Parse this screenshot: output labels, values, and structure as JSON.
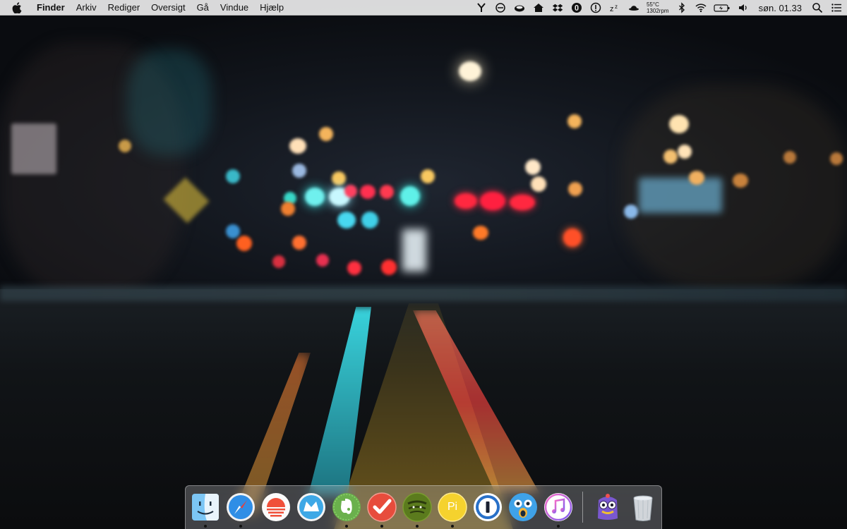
{
  "menubar": {
    "app_name": "Finder",
    "menus": [
      "Arkiv",
      "Rediger",
      "Oversigt",
      "Gå",
      "Vindue",
      "Hjælp"
    ],
    "status": {
      "temperature": "55°C",
      "fan_speed": "1302rpm",
      "clock": "søn. 01.33"
    }
  },
  "status_icons": [
    "fork-icon",
    "do-not-disturb-icon",
    "coffee-icon",
    "home-icon",
    "dropbox-icon",
    "info-circle-icon",
    "alert-circle-icon",
    "sleep-icon",
    "hat-icon",
    "bluetooth-icon",
    "wifi-icon",
    "battery-charging-icon",
    "volume-icon",
    "spotlight-search-icon",
    "notification-center-icon"
  ],
  "dock": {
    "apps": [
      {
        "name": "Finder",
        "icon": "finder-icon",
        "running": true
      },
      {
        "name": "Safari",
        "icon": "safari-icon",
        "running": true
      },
      {
        "name": "Sunrise",
        "icon": "sunrise-icon",
        "running": false
      },
      {
        "name": "Airmail",
        "icon": "airmail-icon",
        "running": false
      },
      {
        "name": "Evernote",
        "icon": "evernote-icon",
        "running": true
      },
      {
        "name": "Wunderlist",
        "icon": "wunderlist-icon",
        "running": true
      },
      {
        "name": "Spotify",
        "icon": "spotify-icon",
        "running": true
      },
      {
        "name": "Pi",
        "icon": "pi-icon",
        "running": true
      },
      {
        "name": "1Password",
        "icon": "onepassword-icon",
        "running": false
      },
      {
        "name": "Tweetbot",
        "icon": "tweetbot-icon",
        "running": false
      },
      {
        "name": "iTunes",
        "icon": "itunes-icon",
        "running": true
      },
      {
        "name": "Monster",
        "icon": "monster-icon",
        "running": false
      },
      {
        "name": "Trash",
        "icon": "trash-icon",
        "running": false
      }
    ],
    "pi_label": "Pi"
  },
  "colors": {
    "menubar_bg": "#ececec",
    "safari_blue": "#2f8ee6",
    "evernote_green": "#6ab04c",
    "wunderlist_red": "#e74c3c",
    "spotify_green": "#5b7b1d",
    "pi_yellow": "#f5d22e"
  }
}
